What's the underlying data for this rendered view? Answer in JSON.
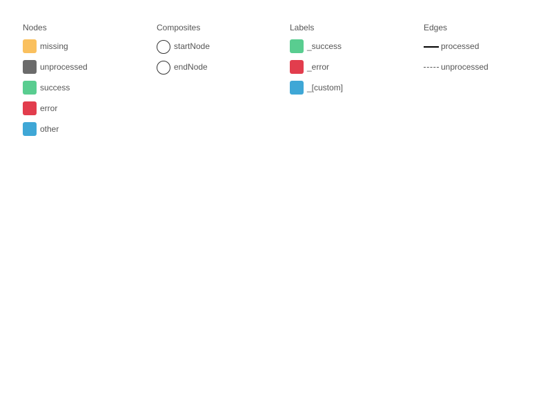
{
  "legend": {
    "nodes": {
      "title": "Nodes",
      "items": [
        {
          "label": "missing",
          "color": "#fac05e"
        },
        {
          "label": "unprocessed",
          "color": "#6b6b6b"
        },
        {
          "label": "success",
          "color": "#59cd90"
        },
        {
          "label": "error",
          "color": "#e23d4d"
        },
        {
          "label": "other",
          "color": "#3fa7d6"
        }
      ]
    },
    "composites": {
      "title": "Composites",
      "items": [
        {
          "label": "startNode",
          "shape": "circle"
        },
        {
          "label": "endNode",
          "shape": "circle"
        }
      ]
    },
    "labels": {
      "title": "Labels",
      "items": [
        {
          "label": "_success",
          "color": "#59cd90"
        },
        {
          "label": "_error",
          "color": "#e23d4d"
        },
        {
          "label": "_[custom]",
          "color": "#3fa7d6"
        }
      ]
    },
    "edges": {
      "title": "Edges",
      "items": [
        {
          "label": "processed",
          "style": "solid",
          "color": "#000000"
        },
        {
          "label": "unprocessed",
          "style": "dashed",
          "color": "#555555"
        }
      ]
    }
  }
}
